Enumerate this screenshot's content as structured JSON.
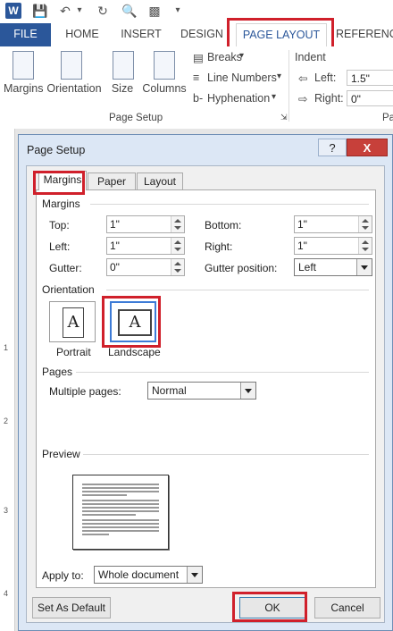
{
  "qat": {
    "save": "save-icon",
    "undo": "undo-icon",
    "redo": "redo-icon",
    "preview": "print-preview-icon"
  },
  "tabs": {
    "file": "FILE",
    "home": "HOME",
    "insert": "INSERT",
    "design": "DESIGN",
    "page_layout": "PAGE LAYOUT",
    "references": "REFERENCE"
  },
  "ribbon": {
    "margins": "Margins",
    "orientation": "Orientation",
    "size": "Size",
    "columns": "Columns",
    "breaks": "Breaks",
    "line_numbers": "Line Numbers",
    "hyphenation": "Hyphenation",
    "group_label": "Page Setup",
    "indent": "Indent",
    "left_label": "Left:",
    "left_value": "1.5\"",
    "right_label": "Right:",
    "right_value": "0\"",
    "pa": "Pa"
  },
  "ruler": {
    "n1": "1",
    "n2": "2",
    "n3": "3",
    "n4": "4"
  },
  "dialog": {
    "title": "Page Setup",
    "help": "?",
    "close": "X",
    "tabs": {
      "margins": "Margins",
      "paper": "Paper",
      "layout": "Layout"
    },
    "margins_section": "Margins",
    "top_label": "Top:",
    "top_value": "1\"",
    "bottom_label": "Bottom:",
    "bottom_value": "1\"",
    "left_label": "Left:",
    "left_value": "1\"",
    "right_label": "Right:",
    "right_value": "1\"",
    "gutter_label": "Gutter:",
    "gutter_value": "0\"",
    "gutter_pos_label": "Gutter position:",
    "gutter_pos_value": "Left",
    "orientation_section": "Orientation",
    "portrait": "Portrait",
    "landscape": "Landscape",
    "page_glyph": "A",
    "pages_section": "Pages",
    "multiple_pages_label": "Multiple pages:",
    "multiple_pages_value": "Normal",
    "preview_section": "Preview",
    "apply_to_label": "Apply to:",
    "apply_to_value": "Whole document",
    "set_default": "Set As Default",
    "ok": "OK",
    "cancel": "Cancel"
  }
}
